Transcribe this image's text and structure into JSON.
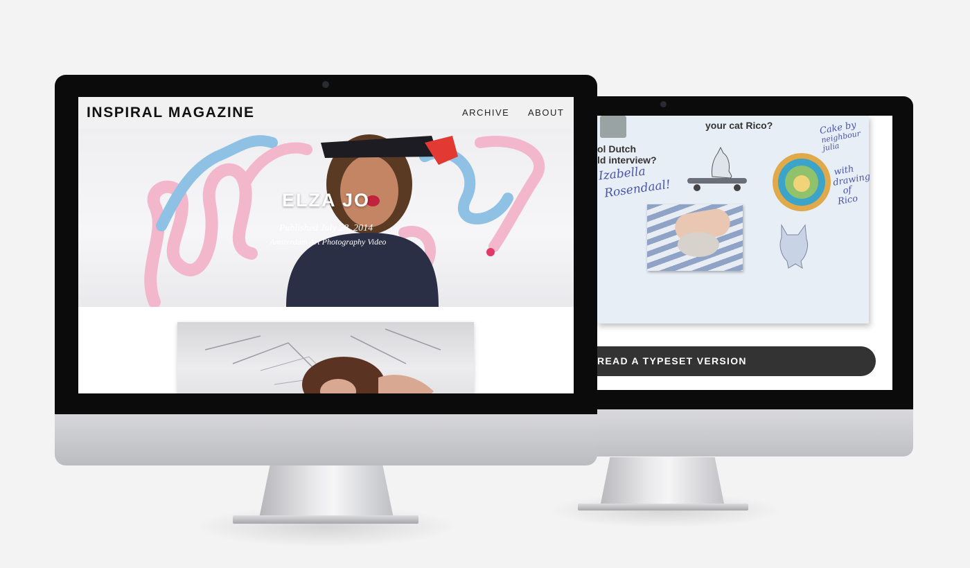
{
  "site": {
    "logo": "INSPIRAL MAGAZINE",
    "nav": [
      "ARCHIVE",
      "ABOUT"
    ]
  },
  "article": {
    "title": "ELZA JO",
    "published": "Published July 28, 2014",
    "tags": "· Amsterdam Art Photography Video"
  },
  "back_screen": {
    "question_1": "your cat Rico?",
    "question_2a": "ol Dutch",
    "question_2b": "ld interview?",
    "handwriting_name_1": "Izabella",
    "handwriting_name_2": "Rosendaal!",
    "handwriting_note": [
      "Cake by",
      "neighbour julia",
      "with",
      "drawing",
      "of",
      "Rico"
    ],
    "button_label": "READ A TYPESET VERSION"
  },
  "colors": {
    "page_bg": "#f3f3f3",
    "bezel": "#0b0b0b",
    "button_bg": "#333333",
    "header_bg": "#f1f1f1",
    "handwriting": "#4a55a8"
  }
}
